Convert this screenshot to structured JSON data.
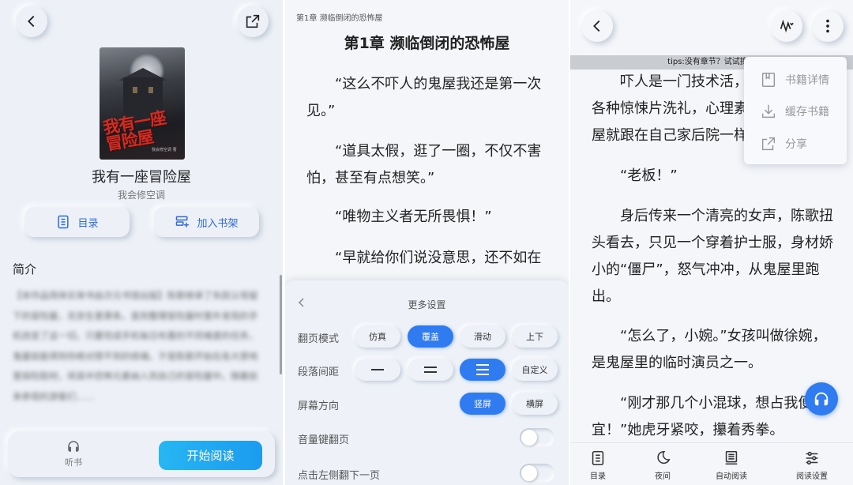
{
  "detail": {
    "book_title": "我有一座冒险屋",
    "author": "我会修空调",
    "cover_title_art": "我有一座冒险屋",
    "cover_author_art": "我会修空调 著",
    "catalog_label": "目录",
    "add_shelf_label": "加入书架",
    "intro_heading": "简介",
    "intro_text": "【本作品简体实体书由次元书馆出版】陈歌继承了失踪父母留下的冒险屋，无奈生意萧条。直到整理冒险屋时意外发现的手机改变了这一切。只要完成手机每日布置的不同难度的任务，鬼屋就能得到你绝对想不到的修缮。于是陈歌开始在各大禁地里探险取材，将其中恐怖元素纳入到自己的冒险屋中。随着前来参观的游客们……",
    "listen_label": "听书",
    "start_label": "开始阅读"
  },
  "reader": {
    "chapter_small": "第1章 濒临倒闭的恐怖屋",
    "chapter_title": "第1章 濒临倒闭的恐怖屋",
    "paragraphs": [
      "“这么不吓人的鬼屋我还是第一次见。”",
      "“道具太假，逛了一圈，不仅不害怕，甚至有点想笑。”",
      "“唯物主义者无所畏惧！”",
      "“早就给你们说没意思，还不如在"
    ]
  },
  "settings": {
    "title": "更多设置",
    "page_mode_label": "翻页模式",
    "page_modes": [
      "仿真",
      "覆盖",
      "滑动",
      "上下"
    ],
    "page_mode_selected": "覆盖",
    "spacing_label": "段落间距",
    "spacing_custom": "自定义",
    "orientation_label": "屏幕方向",
    "orientations": [
      "竖屏",
      "横屏"
    ],
    "orientation_selected": "竖屏",
    "volume_label": "音量键翻页",
    "volume_on": false,
    "tap_left_label": "点击左侧翻下一页",
    "tap_left_on": false
  },
  "reader2": {
    "tips": "tips:没有章节？试试换源",
    "para1_lines": [
      "吓人是一门技术活，",
      "各种惊悚片洗礼，心理素",
      "屋就跟在自己家后院一样"
    ],
    "para2": "“老板！”",
    "para3": "身后传来一个清亮的女声，陈歌扭头看去，只见一个穿着护士服，身材娇小的“僵尸”，怒气冲冲，从鬼屋里跑出。",
    "para4": "“怎么了，小婉。”女孩叫做徐婉，是鬼屋里的临时演员之一。",
    "para5_lines": [
      "“刚才那几个小混球，想占我便",
      "宜！”她虎牙紧咬，攥着秀拳。"
    ],
    "menu": {
      "details": "书籍详情",
      "cache": "缓存书籍",
      "share": "分享"
    },
    "nav": {
      "catalog": "目录",
      "night": "夜间",
      "auto": "自动阅读",
      "settings": "阅读设置"
    }
  },
  "colors": {
    "accent": "#2f7bef",
    "start_button": "#1c9bf0",
    "link_blue": "#2f6ae0"
  }
}
